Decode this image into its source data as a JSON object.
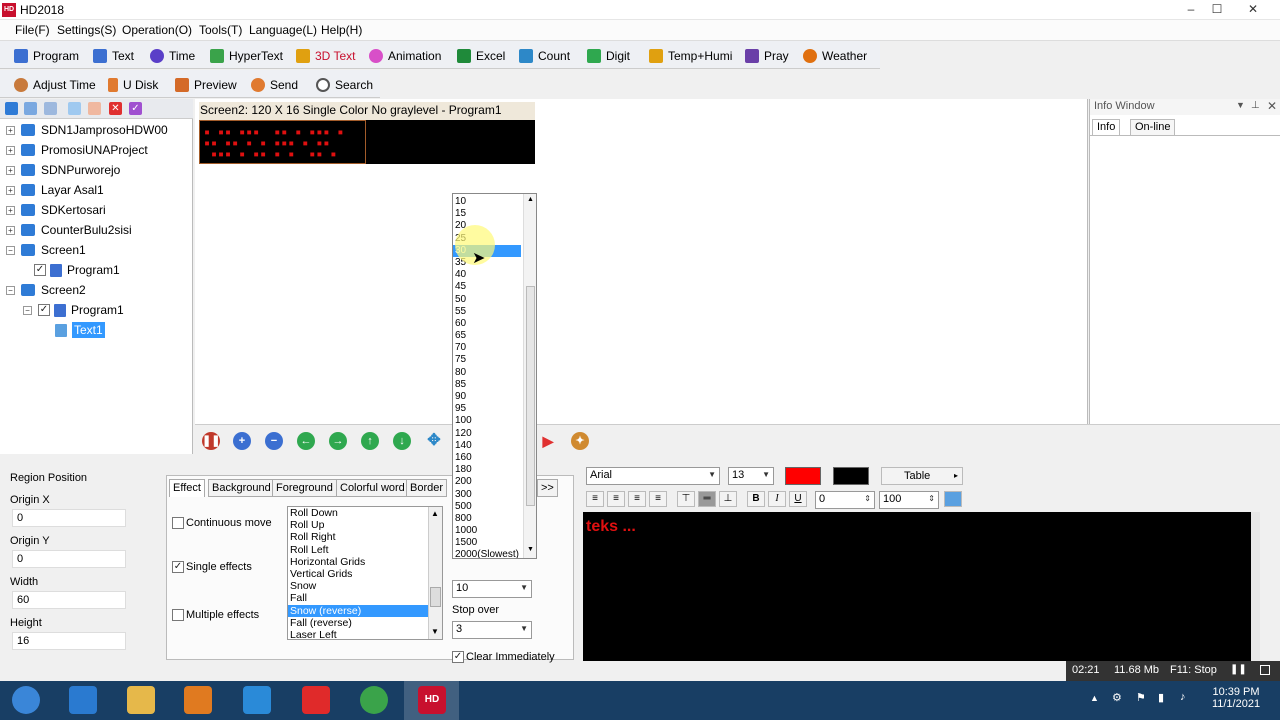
{
  "window": {
    "title": "HD2018",
    "app_icon_text": "HD",
    "controls": [
      "–",
      "☐",
      "✕"
    ]
  },
  "menu": [
    "File(F)",
    "Settings(S)",
    "Operation(O)",
    "Tools(T)",
    "Language(L)",
    "Help(H)"
  ],
  "toolbar1": [
    {
      "label": "Program",
      "icon": "program-icon",
      "color": "#3c6fd1"
    },
    {
      "label": "Text",
      "icon": "text-icon",
      "color": "#3c6fd1"
    },
    {
      "label": "Time",
      "icon": "clock-icon",
      "color": "#5a3fc8"
    },
    {
      "label": "HyperText",
      "icon": "image-icon",
      "color": "#3aa34a"
    },
    {
      "label": "3D Text",
      "icon": "cube-icon",
      "color": "#e0a010"
    },
    {
      "label": "Animation",
      "icon": "flower-icon",
      "color": "#d84fc8"
    },
    {
      "label": "Excel",
      "icon": "excel-icon",
      "color": "#1f8a3a"
    },
    {
      "label": "Count",
      "icon": "count-icon",
      "color": "#2d88c8"
    },
    {
      "label": "Digit",
      "icon": "digit-icon",
      "color": "#2fa84f"
    },
    {
      "label": "Temp+Humi",
      "icon": "thermometer-icon",
      "color": "#e0a010"
    },
    {
      "label": "Pray",
      "icon": "pray-icon",
      "color": "#6a3fa8"
    },
    {
      "label": "Weather",
      "icon": "sun-icon",
      "color": "#e07010"
    }
  ],
  "toolbar1_colors": {
    "3d_text": "#c8102e"
  },
  "toolbar2": [
    {
      "label": "Adjust Time",
      "icon": "adjust-time-icon",
      "color": "#c87a3c"
    },
    {
      "label": "U Disk",
      "icon": "usb-icon",
      "color": "#e07a30"
    },
    {
      "label": "Preview",
      "icon": "preview-icon",
      "color": "#d46a28"
    },
    {
      "label": "Send",
      "icon": "send-icon",
      "color": "#e07a30"
    },
    {
      "label": "Search",
      "icon": "search-icon",
      "color": "#555555"
    }
  ],
  "tree": {
    "items": [
      "SDN1JamprosoHDW00",
      "PromosiUNAProject",
      "SDNPurworejo",
      "Layar Asal1",
      "SDKertosari",
      "CounterBulu2sisi",
      "Screen1"
    ],
    "screen1_program": "Program1",
    "screen2": "Screen2",
    "screen2_program": "Program1",
    "text_item": "Text1"
  },
  "canvas": {
    "screen_header": "Screen2: 120 X 16  Single Color No graylevel - Program1",
    "led_dots": "▪ ▪▪ ▪▪▪  ▪▪ ▪ ▪▪▪ ▪\n▪▪ ▪▪ ▪ ▪ ▪▪▪ ▪ ▪▪\n ▪▪▪ ▪ ▪▪ ▪ ▪  ▪▪ ▪"
  },
  "info_window": {
    "title": "Info Window",
    "tabs": [
      "Info",
      "On-line"
    ]
  },
  "region": {
    "title": "Region Position",
    "fields": [
      {
        "label": "Origin X",
        "value": "0"
      },
      {
        "label": "Origin Y",
        "value": "0"
      },
      {
        "label": "Width",
        "value": "60"
      },
      {
        "label": "Height",
        "value": "16"
      }
    ]
  },
  "effect": {
    "tabs": [
      "Effect",
      "Background",
      "Foreground",
      "Colorful word",
      "Border"
    ],
    "more": ">>",
    "continuous_move": "Continuous move",
    "single_effects": "Single effects",
    "multiple_effects": "Multiple effects",
    "list": [
      "Roll Down",
      "Roll Up",
      "Roll Right",
      "Roll Left",
      "Horizontal Grids",
      "Vertical Grids",
      "Snow",
      "Fall",
      "Snow (reverse)",
      "Fall (reverse)",
      "Laser Left"
    ],
    "selected_effect": "Snow (reverse)",
    "speed_value": "10",
    "stop_over_label": "Stop over",
    "stop_over_value": "3",
    "clear_immediately": "Clear Immediately"
  },
  "dropdown": {
    "options": [
      "10",
      "15",
      "20",
      "25",
      "30",
      "35",
      "40",
      "45",
      "50",
      "55",
      "60",
      "65",
      "70",
      "75",
      "80",
      "85",
      "90",
      "95",
      "100",
      "120",
      "140",
      "160",
      "180",
      "200",
      "300",
      "500",
      "800",
      "1000",
      "1500",
      "2000(Slowest)"
    ],
    "selected": "30"
  },
  "editor": {
    "font": "Arial",
    "size": "13",
    "text_color": "#ff0000",
    "bg_color": "#000000",
    "table_label": "Table",
    "bold": "B",
    "italic": "I",
    "underline": "U",
    "spacing": "0",
    "scale": "100",
    "content": "teks ..."
  },
  "status": {
    "time": "02:21",
    "memory": "11.68 Mb",
    "hint": "F11: Stop"
  },
  "taskbar": {
    "apps": [
      {
        "name": "start-orb-icon",
        "color": "#3a86d8"
      },
      {
        "name": "ie-icon",
        "color": "#2a7ad0"
      },
      {
        "name": "folder-icon",
        "color": "#e6b84a"
      },
      {
        "name": "media-player-icon",
        "color": "#e07a20"
      },
      {
        "name": "screen-capture-icon",
        "color": "#2a8ad8"
      },
      {
        "name": "download-icon",
        "color": "#e02a2a"
      },
      {
        "name": "chrome-icon",
        "color": "#3aa34a"
      },
      {
        "name": "hd-app-icon",
        "color": "#c8102e"
      }
    ],
    "clock_time": "10:39 PM",
    "clock_date": "11/1/2021"
  }
}
